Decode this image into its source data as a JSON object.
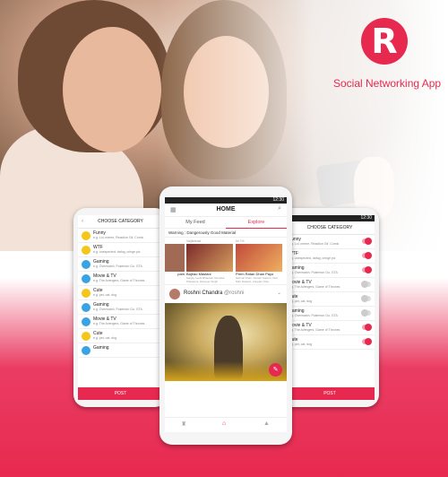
{
  "brand": {
    "logo_letter": "R",
    "tagline": "Social Networking App",
    "accent": "#e8294f"
  },
  "left_phone": {
    "title": "CHOOSE CATEGORY",
    "categories": [
      {
        "name": "Funny",
        "sub": "e.g. Lol, meme, Reaction Gif, Comic",
        "emoji_color": "#f5c518"
      },
      {
        "name": "WTF",
        "sub": "e.g. unexpected, dafug, cringe pic",
        "emoji_color": "#f5c518"
      },
      {
        "name": "Gaming",
        "sub": "e.g. Overwatch, Pokemon Go, GTA",
        "emoji_color": "#3aa3e3"
      },
      {
        "name": "Movie & TV",
        "sub": "e.g. The Avengers, Game of Thrones",
        "emoji_color": "#3aa3e3"
      },
      {
        "name": "Cute",
        "sub": "e.g. pet, cat, dog",
        "emoji_color": "#f5c518"
      },
      {
        "name": "Gaming",
        "sub": "e.g. Overwatch, Pokemon Go, GTA",
        "emoji_color": "#3aa3e3"
      },
      {
        "name": "Movie & TV",
        "sub": "e.g. The Avengers, Game of Thrones",
        "emoji_color": "#3aa3e3"
      },
      {
        "name": "Cute",
        "sub": "e.g. pet, cat, dog",
        "emoji_color": "#f5c518"
      },
      {
        "name": "Gaming",
        "sub": "",
        "emoji_color": "#3aa3e3"
      }
    ],
    "post_label": "POST"
  },
  "center_phone": {
    "time": "12:30",
    "title": "HOME",
    "tabs": [
      "My Feed",
      "Explore"
    ],
    "warning": "Warning : Dangerously Good Material",
    "cards": [
      {
        "tag": "",
        "caption": "pam",
        "sub": ""
      },
      {
        "tag": "Vaijāntraal",
        "caption": "Bajirao Mastani",
        "sub": "Sanjay Leela Bhansali, Deepika Padukone, Ranveer Singh"
      },
      {
        "tag": "Ini 7/4",
        "caption": "Prem Ratan Dhan Payo",
        "sub": "Salman Khan, Sonam Kapoor, Neil Nitin Mukesh, Anupam Kher"
      }
    ],
    "post_author": "Roshni Chandra",
    "post_handle": "@roshni"
  },
  "right_phone": {
    "time": "12:30",
    "title": "CHOOSE CATEGORY",
    "categories": [
      {
        "name": "Funny",
        "sub": "e.g. Lol, meme, Reaction Gif, Comic",
        "on": true
      },
      {
        "name": "WTF",
        "sub": "e.g. unexpected, dafug, cringe pic",
        "on": true
      },
      {
        "name": "Gaming",
        "sub": "e.g. Overwatch, Pokemon Go, GTA",
        "on": true
      },
      {
        "name": "Movie & TV",
        "sub": "e.g. The Avengers, Game of Thrones",
        "on": false
      },
      {
        "name": "Cute",
        "sub": "e.g. pet, cat, dog",
        "on": false
      },
      {
        "name": "Gaming",
        "sub": "e.g. Overwatch, Pokemon Go, GTA",
        "on": false
      },
      {
        "name": "Movie & TV",
        "sub": "e.g. The Avengers, Game of Thrones",
        "on": true
      },
      {
        "name": "Cute",
        "sub": "e.g. pet, cat, dog",
        "on": true
      }
    ],
    "post_label": "POST"
  }
}
